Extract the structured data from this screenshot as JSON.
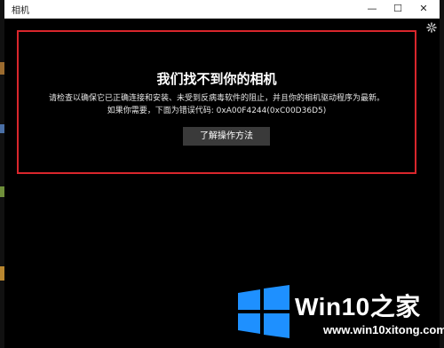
{
  "window": {
    "title": "相机",
    "controls": {
      "minimize": "—",
      "maximize": "☐",
      "close": "✕"
    }
  },
  "settings": {
    "icon": "gear-icon"
  },
  "error": {
    "title": "我们找不到你的相机",
    "line1": "请检查以确保它已正确连接和安装、未受到反病毒软件的阻止，并且你的相机驱动程序为最新。",
    "line2": "如果你需要，下面为错误代码: 0xA00F4244(0xC00D36D5)",
    "button_label": "了解操作方法"
  },
  "watermark": {
    "brand": "Win10之家",
    "url": "www.win10xitong.com",
    "logo_icon": "windows-logo-icon"
  },
  "colors": {
    "highlight_border": "#d9262c",
    "window_bg": "#000000",
    "titlebar_bg": "#ffffff",
    "button_bg": "#3a3a3a",
    "logo_blue": "#1e90ff"
  }
}
